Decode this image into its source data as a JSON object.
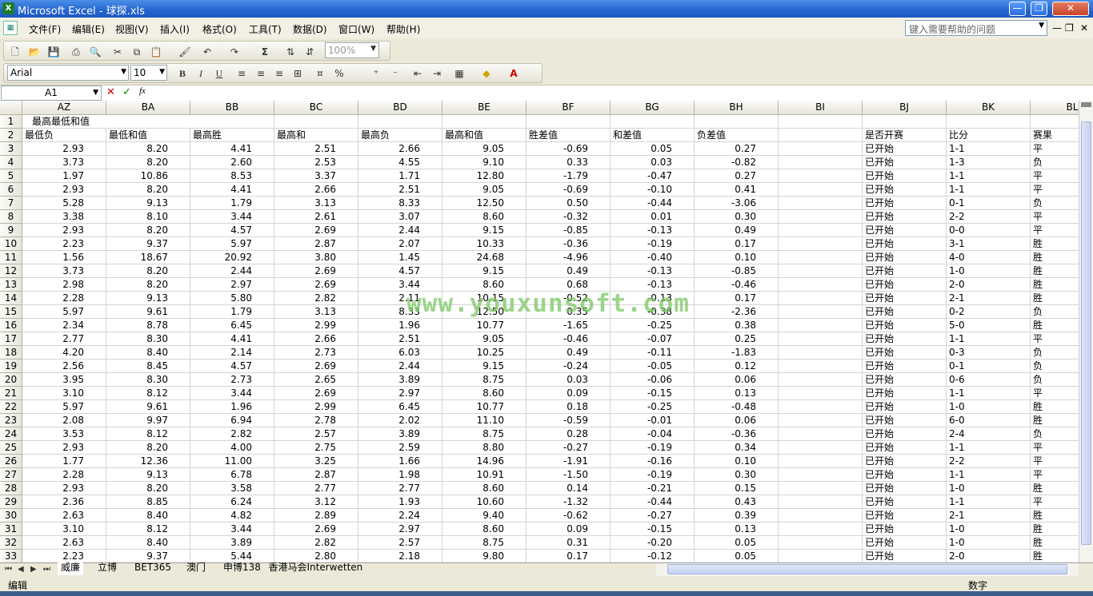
{
  "window": {
    "title": "Microsoft Excel - 球探.xls",
    "minimize": "—",
    "maximize": "❐",
    "close": "✕"
  },
  "menu": [
    "文件(F)",
    "编辑(E)",
    "视图(V)",
    "插入(I)",
    "格式(O)",
    "工具(T)",
    "数据(D)",
    "窗口(W)",
    "帮助(H)"
  ],
  "help": {
    "placeholder": "键入需要帮助的问题"
  },
  "toolbar": {
    "zoom": "100%"
  },
  "format": {
    "font": "Arial",
    "size": "10",
    "bold": "B",
    "italic": "I",
    "underline": "U"
  },
  "formula": {
    "cell_ref": "A1",
    "fx": "fx"
  },
  "columns": [
    "AZ",
    "BA",
    "BB",
    "BC",
    "BD",
    "BE",
    "BF",
    "BG",
    "BH",
    "BI",
    "BJ",
    "BK",
    "BL"
  ],
  "row1": {
    "row": "1",
    "text": "最高最低和值"
  },
  "headers": {
    "row": "2",
    "cells": [
      "最低负",
      "最低和值",
      "最高胜",
      "最高和",
      "最高负",
      "最高和值",
      "胜差值",
      "和差值",
      "负差值",
      "",
      "是否开赛",
      "比分",
      "赛果"
    ]
  },
  "rows": [
    {
      "n": "3",
      "c": [
        "2.93",
        "8.20",
        "4.41",
        "2.51",
        "2.66",
        "9.05",
        "-0.69",
        "0.05",
        "0.27",
        "",
        "已开始",
        "1-1",
        "平"
      ]
    },
    {
      "n": "4",
      "c": [
        "3.73",
        "8.20",
        "2.60",
        "2.53",
        "4.55",
        "9.10",
        "0.33",
        "0.03",
        "-0.82",
        "",
        "已开始",
        "1-3",
        "负"
      ]
    },
    {
      "n": "5",
      "c": [
        "1.97",
        "10.86",
        "8.53",
        "3.37",
        "1.71",
        "12.80",
        "-1.79",
        "-0.47",
        "0.27",
        "",
        "已开始",
        "1-1",
        "平"
      ]
    },
    {
      "n": "6",
      "c": [
        "2.93",
        "8.20",
        "4.41",
        "2.66",
        "2.51",
        "9.05",
        "-0.69",
        "-0.10",
        "0.41",
        "",
        "已开始",
        "1-1",
        "平"
      ]
    },
    {
      "n": "7",
      "c": [
        "5.28",
        "9.13",
        "1.79",
        "3.13",
        "8.33",
        "12.50",
        "0.50",
        "-0.44",
        "-3.06",
        "",
        "已开始",
        "0-1",
        "负"
      ]
    },
    {
      "n": "8",
      "c": [
        "3.38",
        "8.10",
        "3.44",
        "2.61",
        "3.07",
        "8.60",
        "-0.32",
        "0.01",
        "0.30",
        "",
        "已开始",
        "2-2",
        "平"
      ]
    },
    {
      "n": "9",
      "c": [
        "2.93",
        "8.20",
        "4.57",
        "2.69",
        "2.44",
        "9.15",
        "-0.85",
        "-0.13",
        "0.49",
        "",
        "已开始",
        "0-0",
        "平"
      ]
    },
    {
      "n": "10",
      "c": [
        "2.23",
        "9.37",
        "5.97",
        "2.87",
        "2.07",
        "10.33",
        "-0.36",
        "-0.19",
        "0.17",
        "",
        "已开始",
        "3-1",
        "胜"
      ]
    },
    {
      "n": "11",
      "c": [
        "1.56",
        "18.67",
        "20.92",
        "3.80",
        "1.45",
        "24.68",
        "-4.96",
        "-0.40",
        "0.10",
        "",
        "已开始",
        "4-0",
        "胜"
      ]
    },
    {
      "n": "12",
      "c": [
        "3.73",
        "8.20",
        "2.44",
        "2.69",
        "4.57",
        "9.15",
        "0.49",
        "-0.13",
        "-0.85",
        "",
        "已开始",
        "1-0",
        "胜"
      ]
    },
    {
      "n": "13",
      "c": [
        "2.98",
        "8.20",
        "2.97",
        "2.69",
        "3.44",
        "8.60",
        "0.68",
        "-0.13",
        "-0.46",
        "",
        "已开始",
        "2-0",
        "胜"
      ]
    },
    {
      "n": "14",
      "c": [
        "2.28",
        "9.13",
        "5.80",
        "2.82",
        "2.11",
        "10.15",
        "-0.52",
        "-0.13",
        "0.17",
        "",
        "已开始",
        "2-1",
        "胜"
      ]
    },
    {
      "n": "15",
      "c": [
        "5.97",
        "9.61",
        "1.79",
        "3.13",
        "8.33",
        "12.50",
        "0.35",
        "-0.38",
        "-2.36",
        "",
        "已开始",
        "0-2",
        "负"
      ]
    },
    {
      "n": "16",
      "c": [
        "2.34",
        "8.78",
        "6.45",
        "2.99",
        "1.96",
        "10.77",
        "-1.65",
        "-0.25",
        "0.38",
        "",
        "已开始",
        "5-0",
        "胜"
      ]
    },
    {
      "n": "17",
      "c": [
        "2.77",
        "8.30",
        "4.41",
        "2.66",
        "2.51",
        "9.05",
        "-0.46",
        "-0.07",
        "0.25",
        "",
        "已开始",
        "1-1",
        "平"
      ]
    },
    {
      "n": "18",
      "c": [
        "4.20",
        "8.40",
        "2.14",
        "2.73",
        "6.03",
        "10.25",
        "0.49",
        "-0.11",
        "-1.83",
        "",
        "已开始",
        "0-3",
        "负"
      ]
    },
    {
      "n": "19",
      "c": [
        "2.56",
        "8.45",
        "4.57",
        "2.69",
        "2.44",
        "9.15",
        "-0.24",
        "-0.05",
        "0.12",
        "",
        "已开始",
        "0-1",
        "负"
      ]
    },
    {
      "n": "20",
      "c": [
        "3.95",
        "8.30",
        "2.73",
        "2.65",
        "3.89",
        "8.75",
        "0.03",
        "-0.06",
        "0.06",
        "",
        "已开始",
        "0-6",
        "负"
      ]
    },
    {
      "n": "21",
      "c": [
        "3.10",
        "8.12",
        "3.44",
        "2.69",
        "2.97",
        "8.60",
        "0.09",
        "-0.15",
        "0.13",
        "",
        "已开始",
        "1-1",
        "平"
      ]
    },
    {
      "n": "22",
      "c": [
        "5.97",
        "9.61",
        "1.96",
        "2.99",
        "6.45",
        "10.77",
        "0.18",
        "-0.25",
        "-0.48",
        "",
        "已开始",
        "1-0",
        "胜"
      ]
    },
    {
      "n": "23",
      "c": [
        "2.08",
        "9.97",
        "6.94",
        "2.78",
        "2.02",
        "11.10",
        "-0.59",
        "-0.01",
        "0.06",
        "",
        "已开始",
        "6-0",
        "胜"
      ]
    },
    {
      "n": "24",
      "c": [
        "3.53",
        "8.12",
        "2.82",
        "2.57",
        "3.89",
        "8.75",
        "0.28",
        "-0.04",
        "-0.36",
        "",
        "已开始",
        "2-4",
        "负"
      ]
    },
    {
      "n": "25",
      "c": [
        "2.93",
        "8.20",
        "4.00",
        "2.75",
        "2.59",
        "8.80",
        "-0.27",
        "-0.19",
        "0.34",
        "",
        "已开始",
        "1-1",
        "平"
      ]
    },
    {
      "n": "26",
      "c": [
        "1.77",
        "12.36",
        "11.00",
        "3.25",
        "1.66",
        "14.96",
        "-1.91",
        "-0.16",
        "0.10",
        "",
        "已开始",
        "2-2",
        "平"
      ]
    },
    {
      "n": "27",
      "c": [
        "2.28",
        "9.13",
        "6.78",
        "2.87",
        "1.98",
        "10.91",
        "-1.50",
        "-0.19",
        "0.30",
        "",
        "已开始",
        "1-1",
        "平"
      ]
    },
    {
      "n": "28",
      "c": [
        "2.93",
        "8.20",
        "3.58",
        "2.77",
        "2.77",
        "8.60",
        "0.14",
        "-0.21",
        "0.15",
        "",
        "已开始",
        "1-0",
        "胜"
      ]
    },
    {
      "n": "29",
      "c": [
        "2.36",
        "8.85",
        "6.24",
        "3.12",
        "1.93",
        "10.60",
        "-1.32",
        "-0.44",
        "0.43",
        "",
        "已开始",
        "1-1",
        "平"
      ]
    },
    {
      "n": "30",
      "c": [
        "2.63",
        "8.40",
        "4.82",
        "2.89",
        "2.24",
        "9.40",
        "-0.62",
        "-0.27",
        "0.39",
        "",
        "已开始",
        "2-1",
        "胜"
      ]
    },
    {
      "n": "31",
      "c": [
        "3.10",
        "8.12",
        "3.44",
        "2.69",
        "2.97",
        "8.60",
        "0.09",
        "-0.15",
        "0.13",
        "",
        "已开始",
        "1-0",
        "胜"
      ]
    },
    {
      "n": "32",
      "c": [
        "2.63",
        "8.40",
        "3.89",
        "2.82",
        "2.57",
        "8.75",
        "0.31",
        "-0.20",
        "0.05",
        "",
        "已开始",
        "1-0",
        "胜"
      ]
    },
    {
      "n": "33",
      "c": [
        "2.23",
        "9.37",
        "5.44",
        "2.80",
        "2.18",
        "9.80",
        "0.17",
        "-0.12",
        "0.05",
        "",
        "已开始",
        "2-0",
        "胜"
      ]
    }
  ],
  "watermark": "www.youxunsoft.com",
  "sheets": [
    "威廉",
    "立博",
    "BET365",
    "澳门",
    "申博138",
    "香港马会",
    "Interwetten"
  ],
  "active_sheet": 0,
  "status": {
    "mode": "编辑",
    "numlock": "数字"
  }
}
